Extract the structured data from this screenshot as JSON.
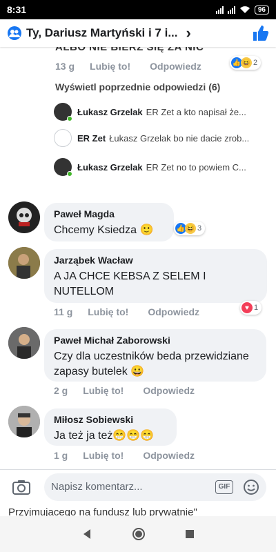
{
  "status": {
    "time": "8:31",
    "battery": "96"
  },
  "header": {
    "title": "Ty, Dariusz Martyński i 7 i..."
  },
  "top": {
    "cut_text": "ALBO NIE BIERZ SIĘ ZA NIC",
    "time": "13 g",
    "like": "Lubię to!",
    "reply": "Odpowiedz",
    "reaction_count": "2"
  },
  "view_previous": "Wyświetl poprzednie odpowiedzi (6)",
  "replies": [
    {
      "name": "Łukasz Grzelak",
      "text": "ER Zet a kto napisał że..."
    },
    {
      "name": "ER Zet",
      "text": "Łukasz Grzelak bo nie dacie zrob..."
    },
    {
      "name": "Łukasz Grzelak",
      "text": "ER Zet no to powiem C..."
    }
  ],
  "comments": [
    {
      "name": "Paweł Magda",
      "text": "Chcemy Ksiedza 🙂",
      "reaction_count": "3"
    },
    {
      "name": "Jarząbek Wacław",
      "text": "A JA CHCE KEBSA Z SELEM I NUTELLOM",
      "time": "11 g",
      "like": "Lubię to!",
      "reply": "Odpowiedz",
      "reaction_count": "1"
    },
    {
      "name": "Paweł Michał Zaborowski",
      "text": "Czy dla uczestników beda przewidziane zapasy butelek 😀",
      "time": "2 g",
      "like": "Lubię to!",
      "reply": "Odpowiedz"
    },
    {
      "name": "Miłosz Sobiewski",
      "text": "Ja też ja też😁😁😁",
      "time": "1 g",
      "like": "Lubię to!",
      "reply": "Odpowiedz"
    }
  ],
  "composer": {
    "placeholder": "Napisz komentarz...",
    "gif": "GIF"
  },
  "background_text": "Przyjmujacego na fundusz lub prywatnie\"",
  "colors": {
    "accent": "#1877f2",
    "bubble": "#f0f2f5",
    "meta": "#8d949e",
    "love": "#f33e58",
    "online": "#42b72a"
  }
}
